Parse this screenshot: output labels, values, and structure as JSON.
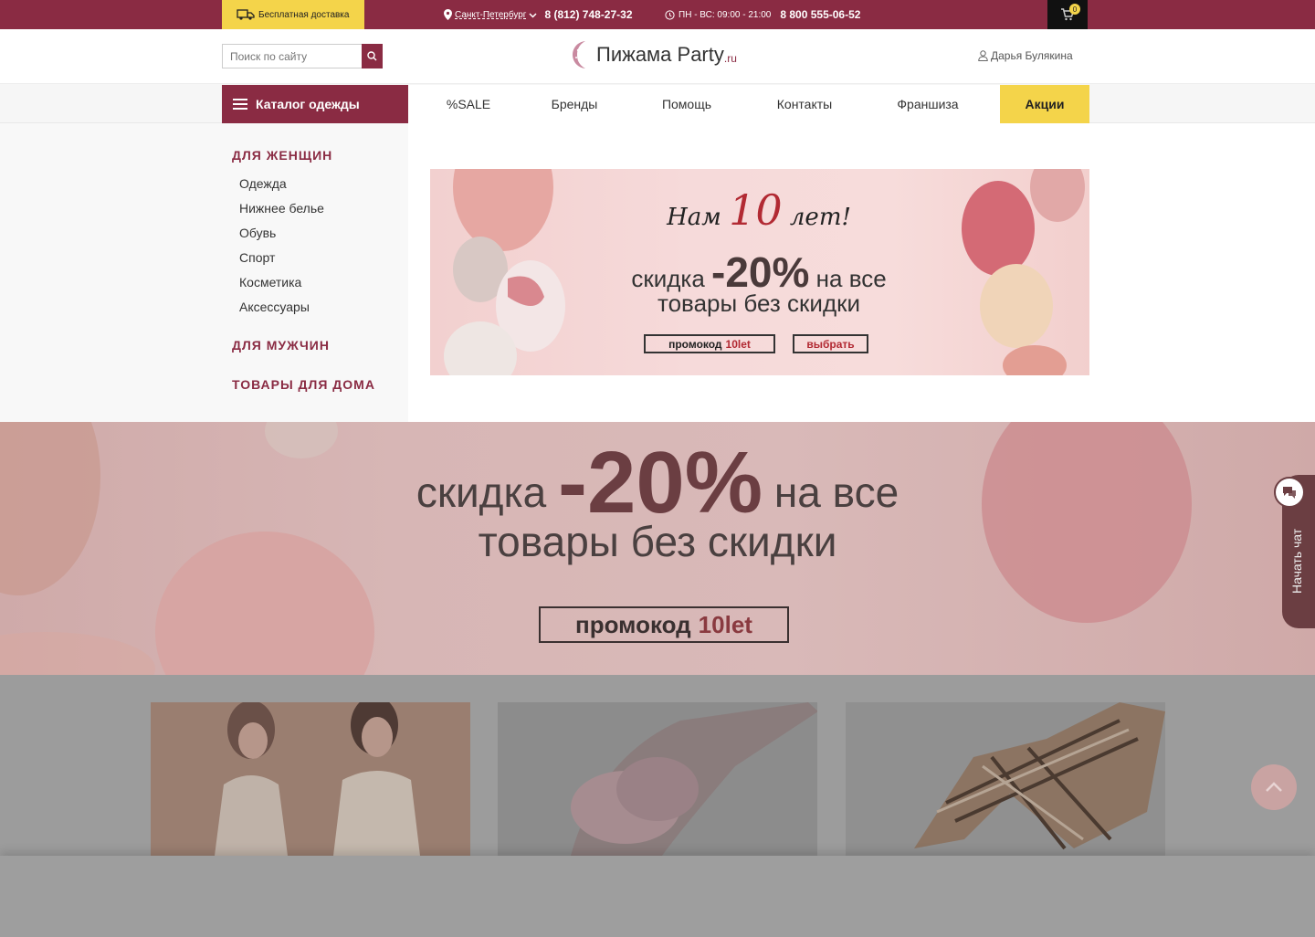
{
  "topbar": {
    "delivery_label": "Бесплатная доставка",
    "city": "Санкт-Петербург",
    "phone_city": "8 (812) 748-27-32",
    "hours": "ПН - ВС: 09:00 - 21:00",
    "phone_free": "8 800 555-06-52",
    "cart_count": "0"
  },
  "header": {
    "search_placeholder": "Поиск по сайту",
    "logo_text": "Пижама Party",
    "logo_suffix": ".ru",
    "user_name": "Дарья Булякина"
  },
  "nav": {
    "catalog_label": "Каталог одежды",
    "links": [
      "%SALE",
      "Бренды",
      "Помощь",
      "Контакты",
      "Франшиза"
    ],
    "promo_label": "Акции"
  },
  "catalog_menu": {
    "women": {
      "heading": "ДЛЯ ЖЕНЩИН",
      "items": [
        "Одежда",
        "Нижнее белье",
        "Обувь",
        "Спорт",
        "Косметика",
        "Аксессуары"
      ]
    },
    "men_heading": "ДЛЯ МУЖЧИН",
    "home_heading": "ТОВАРЫ ДЛЯ ДОМА"
  },
  "small_banner": {
    "title_pre": "Нам",
    "title_num": "10",
    "title_post": "лет!",
    "line1_pre": "скидка",
    "line1_big": "-20%",
    "line1_post": "на все",
    "line2": "товары без скидки",
    "promo_label": "промокод",
    "promo_code": "10let",
    "choose_label": "выбрать"
  },
  "big_banner": {
    "line1_pre": "скидка",
    "line1_big": "-20%",
    "line1_post": "на все",
    "line2": "товары без скидки",
    "promo_label": "промокод",
    "promo_code": "10let"
  },
  "chat": {
    "label": "Начать чат"
  },
  "colors": {
    "brand": "#8a2b43",
    "accent": "#f4d44a",
    "dark": "#111111"
  }
}
